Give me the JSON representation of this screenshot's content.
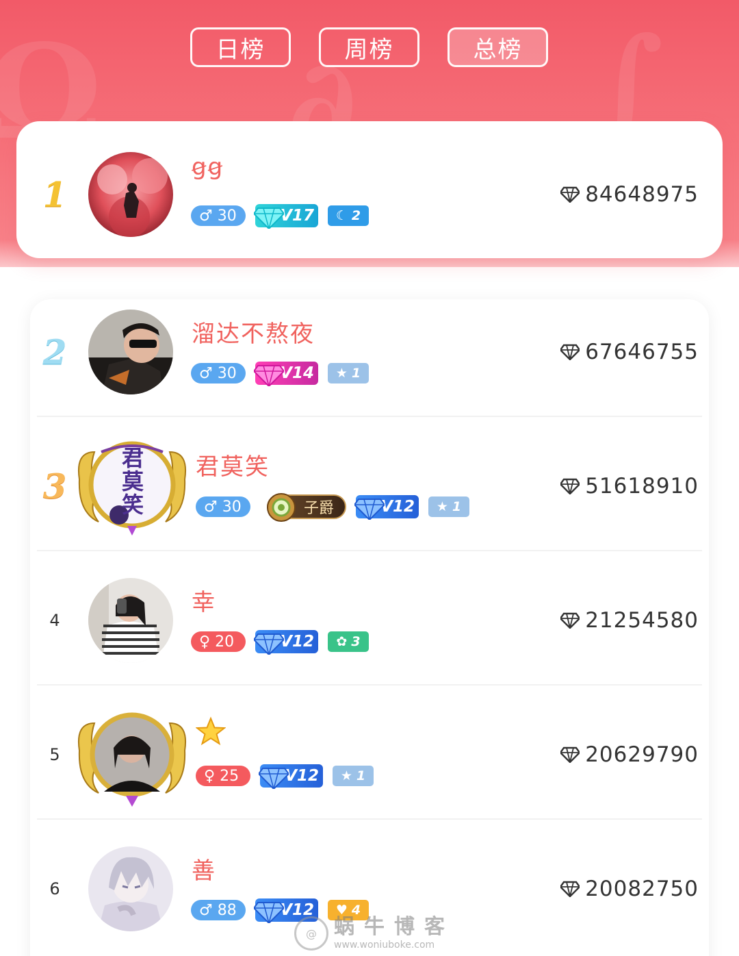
{
  "tabs": [
    {
      "label": "日榜",
      "active": false
    },
    {
      "label": "周榜",
      "active": false
    },
    {
      "label": "总榜",
      "active": true
    }
  ],
  "entries": [
    {
      "rank": "1",
      "name": "ꞡꞡ",
      "age": "30",
      "gender": "male",
      "vip": "V17",
      "vip_color": "cyan",
      "extra_badge": {
        "type": "moon",
        "value": "2"
      },
      "score": "84648975"
    },
    {
      "rank": "2",
      "name": "溜达不熬夜",
      "age": "30",
      "gender": "male",
      "vip": "V14",
      "vip_color": "pink",
      "extra_badge": {
        "type": "star",
        "value": "1"
      },
      "score": "67646755"
    },
    {
      "rank": "3",
      "name": "君莫笑",
      "age": "30",
      "gender": "male",
      "noble": "子爵",
      "vip": "V12",
      "vip_color": "blue",
      "extra_badge": {
        "type": "star",
        "value": "1"
      },
      "score": "51618910",
      "avatar_frame_text": [
        "君",
        "莫",
        "笑"
      ]
    },
    {
      "rank": "4",
      "name": "幸",
      "age": "20",
      "gender": "female",
      "vip": "V12",
      "vip_color": "blue",
      "extra_badge": {
        "type": "gear",
        "value": "3"
      },
      "score": "21254580"
    },
    {
      "rank": "5",
      "name": "",
      "age": "25",
      "gender": "female",
      "vip": "V12",
      "vip_color": "blue",
      "extra_badge": {
        "type": "star",
        "value": "1"
      },
      "score": "20629790"
    },
    {
      "rank": "6",
      "name": "善",
      "age": "88",
      "gender": "male",
      "vip": "V12",
      "vip_color": "blue",
      "extra_badge": {
        "type": "heart",
        "value": "4"
      },
      "score": "20082750"
    }
  ],
  "watermark": {
    "title": "蜗牛博客",
    "url": "www.woniuboke.com"
  },
  "icons": {
    "currency": "diamond-icon",
    "male": "male-symbol-icon",
    "female": "female-symbol-icon"
  },
  "colors": {
    "header": "#f25a68",
    "name": "#f0625e",
    "male_badge": "#5aa7f0",
    "female_badge": "#f45a5e"
  }
}
